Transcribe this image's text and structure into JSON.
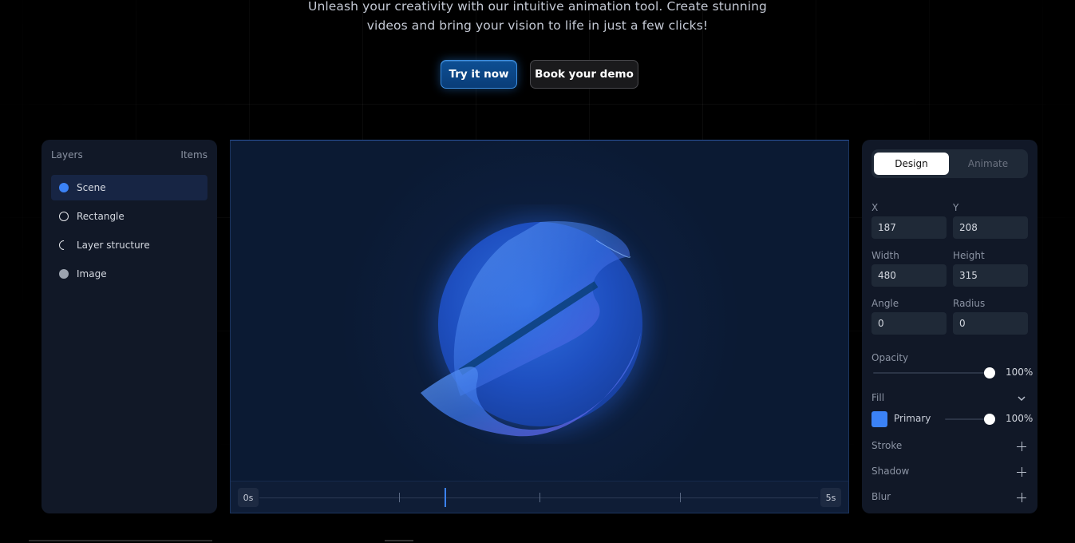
{
  "hero": {
    "subtitle_line1": "Unleash your creativity with our intuitive animation tool. Create stunning",
    "subtitle_line2": "videos and bring your vision to life in just a few clicks!",
    "primary_cta": "Try it now",
    "secondary_cta": "Book your demo"
  },
  "layers": {
    "title": "Layers",
    "items_label": "Items",
    "items": [
      {
        "label": "Scene",
        "icon": "filled-blue-circle-icon",
        "active": true
      },
      {
        "label": "Rectangle",
        "icon": "outline-circle-icon"
      },
      {
        "label": "Layer structure",
        "icon": "partial-circle-icon"
      },
      {
        "label": "Image",
        "icon": "gray-circle-icon"
      }
    ]
  },
  "timeline": {
    "start_label": "0s",
    "end_label": "5s"
  },
  "properties": {
    "tabs": {
      "design": "Design",
      "animate": "Animate",
      "active": "Design"
    },
    "x_label": "X",
    "x_value": "187",
    "y_label": "Y",
    "y_value": "208",
    "width_label": "Width",
    "width_value": "480",
    "height_label": "Height",
    "height_value": "315",
    "angle_label": "Angle",
    "angle_value": "0",
    "radius_label": "Radius",
    "radius_value": "0",
    "opacity_label": "Opacity",
    "opacity_value": "100%",
    "fill_label": "Fill",
    "fill_name": "Primary",
    "fill_value": "100%",
    "fill_color": "#3b82f6",
    "stroke_label": "Stroke",
    "shadow_label": "Shadow",
    "blur_label": "Blur"
  },
  "colors": {
    "accent": "#3b82f6",
    "panel": "#111827",
    "canvas": "#0b1a33"
  }
}
